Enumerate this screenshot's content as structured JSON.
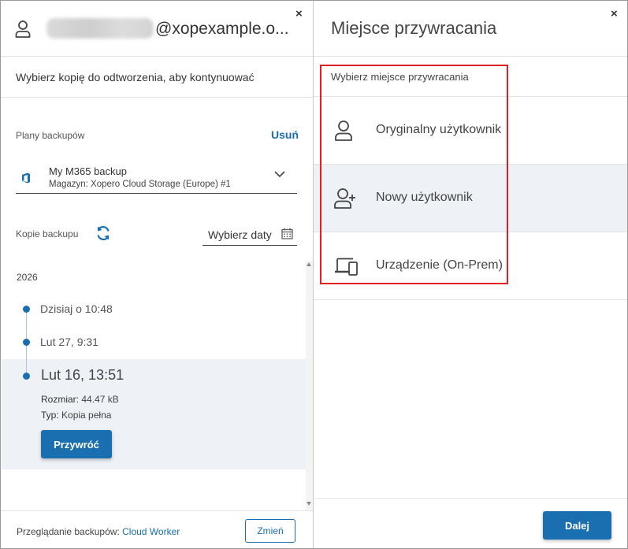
{
  "left_panel": {
    "account_suffix": "@xopexample.o...",
    "close_symbol": "×",
    "subtitle": "Wybierz kopię do odtworzenia, aby kontynuować",
    "plans_label": "Plany backupów",
    "remove_label": "Usuń",
    "plan": {
      "name": "My M365 backup",
      "storage": "Magazyn: Xopero Cloud Storage (Europe) #1"
    },
    "copies_label": "Kopie backupu",
    "date_picker_label": "Wybierz daty",
    "year": "2026",
    "entries": [
      {
        "label": "Dzisiaj o 10:48"
      },
      {
        "label": "Lut 27, 9:31"
      }
    ],
    "selected_entry": {
      "label": "Lut 16, 13:51",
      "size_key": "Rozmiar:",
      "size_value": "44.47 kB",
      "type_key": "Typ:",
      "type_value": "Kopia pełna",
      "restore_label": "Przywróć"
    },
    "footer": {
      "browse_text": "Przeglądanie backupów:",
      "browse_link": "Cloud Worker",
      "change_label": "Zmień"
    }
  },
  "right_panel": {
    "title": "Miejsce przywracania",
    "close_symbol": "×",
    "choose_label": "Wybierz miejsce przywracania",
    "options": [
      {
        "label": "Oryginalny użytkownik",
        "icon": "user-icon"
      },
      {
        "label": "Nowy użytkownik",
        "icon": "user-plus-icon"
      },
      {
        "label": "Urządzenie (On-Prem)",
        "icon": "devices-icon"
      }
    ],
    "next_label": "Dalej"
  },
  "colors": {
    "accent": "#1a6fb0",
    "highlight": "#e02020",
    "hover_row": "#eef1f5"
  }
}
